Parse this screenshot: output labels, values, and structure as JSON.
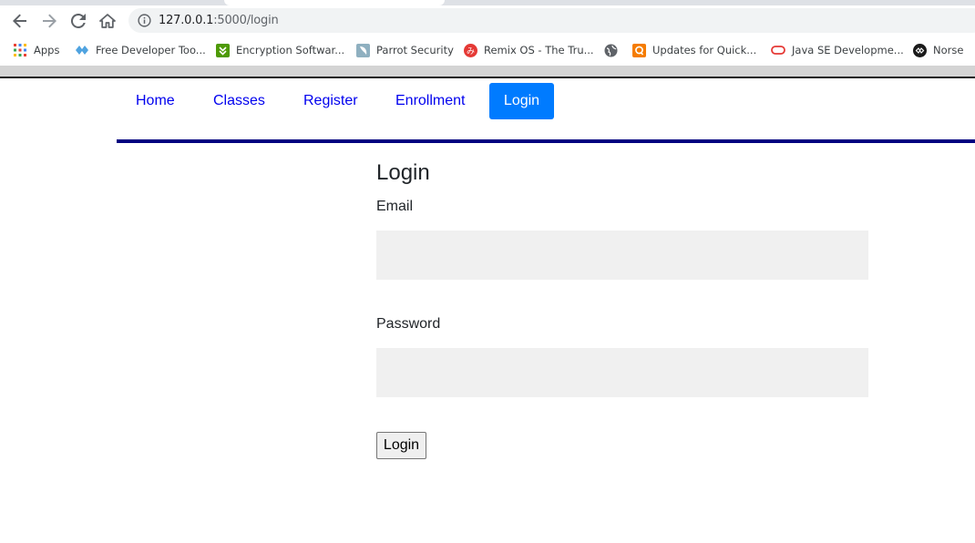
{
  "browser": {
    "url_host": "127.0.0.1",
    "url_rest": ":5000/login",
    "bookmarks": [
      {
        "label": "Apps",
        "icon": "apps-grid-icon",
        "color": "#ea4335"
      },
      {
        "label": "Free Developer Too...",
        "icon": "developer-tools-icon",
        "color": "#4fa3e0"
      },
      {
        "label": "Encryption Softwar...",
        "icon": "encryption-icon",
        "color": "#4e9a06"
      },
      {
        "label": "Parrot Security",
        "icon": "parrot-icon",
        "color": "#7fa3b5"
      },
      {
        "label": "Remix OS - The Tru...",
        "icon": "remix-os-icon",
        "color": "#e53935"
      },
      {
        "label": "",
        "icon": "globe-icon",
        "color": "#5f6368"
      },
      {
        "label": "Updates for Quick...",
        "icon": "quick-updates-icon",
        "color": "#f57c00"
      },
      {
        "label": "Java SE Developme...",
        "icon": "oracle-icon",
        "color": "#e53935"
      },
      {
        "label": "Norse",
        "icon": "norse-icon",
        "color": "#1a1a1a"
      }
    ]
  },
  "nav": {
    "items": [
      {
        "label": "Home",
        "active": false
      },
      {
        "label": "Classes",
        "active": false
      },
      {
        "label": "Register",
        "active": false
      },
      {
        "label": "Enrollment",
        "active": false
      },
      {
        "label": "Login",
        "active": true
      }
    ],
    "accent_color": "#007bff",
    "underline_color": "#000080"
  },
  "form": {
    "title": "Login",
    "email_label": "Email",
    "email_value": "",
    "password_label": "Password",
    "password_value": "",
    "submit_label": "Login"
  }
}
